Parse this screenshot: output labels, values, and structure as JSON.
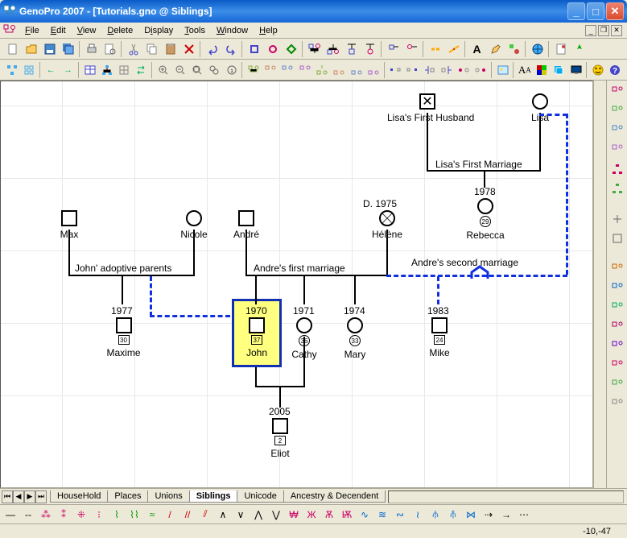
{
  "window": {
    "title": "GenoPro 2007 - [Tutorials.gno @ Siblings]"
  },
  "menu": {
    "items": [
      "File",
      "Edit",
      "View",
      "Delete",
      "Display",
      "Tools",
      "Window",
      "Help"
    ]
  },
  "tabs": {
    "items": [
      "HouseHold",
      "Places",
      "Unions",
      "Siblings",
      "Unicode",
      "Ancestry & Decendent"
    ],
    "active": "Siblings"
  },
  "status": {
    "coords": "-10,-47"
  },
  "people": {
    "lisa_husband": {
      "name": "Lisa's First Husband"
    },
    "lisa": {
      "name": "Lisa"
    },
    "max": {
      "name": "Max"
    },
    "nicole": {
      "name": "Nicole"
    },
    "andre": {
      "name": "André"
    },
    "helene": {
      "name": "Hélène",
      "death": "D. 1975"
    },
    "rebecca": {
      "name": "Rebecca",
      "age": "29"
    },
    "maxime": {
      "name": "Maxime",
      "year": "1977",
      "age": "30"
    },
    "john": {
      "name": "John",
      "year": "1970",
      "age": "37"
    },
    "cathy": {
      "name": "Cathy",
      "year": "1971",
      "age": "36"
    },
    "mary": {
      "name": "Mary",
      "year": "1974",
      "age": "33"
    },
    "mike": {
      "name": "Mike",
      "year": "1983",
      "age": "24"
    },
    "eliot": {
      "name": "Eliot",
      "year": "2005",
      "age": "2"
    }
  },
  "relationships": {
    "lisa_first": {
      "label": "Lisa's First Marriage",
      "year": "1978"
    },
    "john_adoptive": {
      "label": "John' adoptive parents"
    },
    "andre_first": {
      "label": "Andre's first marriage"
    },
    "andre_second": {
      "label": "Andre's second marriage"
    }
  }
}
